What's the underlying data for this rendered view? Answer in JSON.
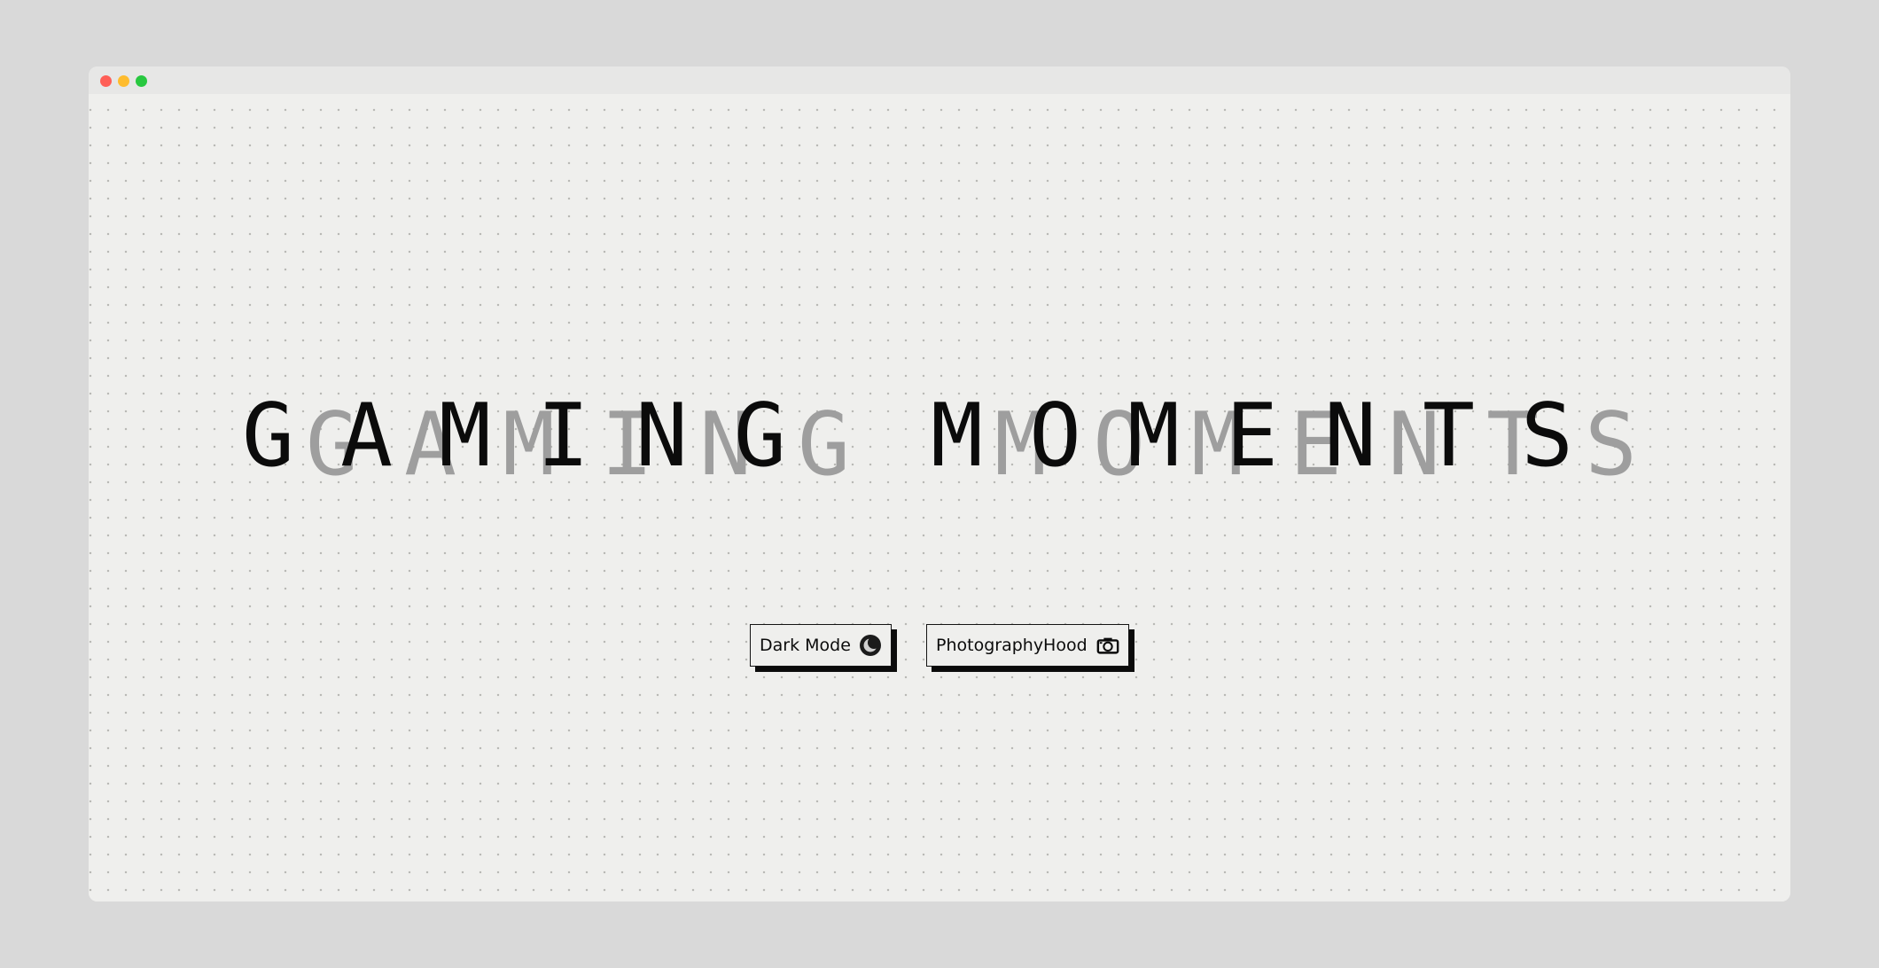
{
  "hero": {
    "title": "GAMING MOMENTS",
    "shadow_title": "GAMING MOMENTS"
  },
  "buttons": {
    "dark_mode_label": "Dark Mode",
    "dark_mode_icon": "moon-icon",
    "photography_label": "PhotographyHood",
    "photography_icon": "camera-icon"
  },
  "colors": {
    "background": "#efefed",
    "frame": "#d9d9d9",
    "text": "#0b0b0b",
    "shadow_text": "#9e9e9e",
    "traffic_close": "#ff5f57",
    "traffic_min": "#febc2e",
    "traffic_max": "#28c840"
  }
}
